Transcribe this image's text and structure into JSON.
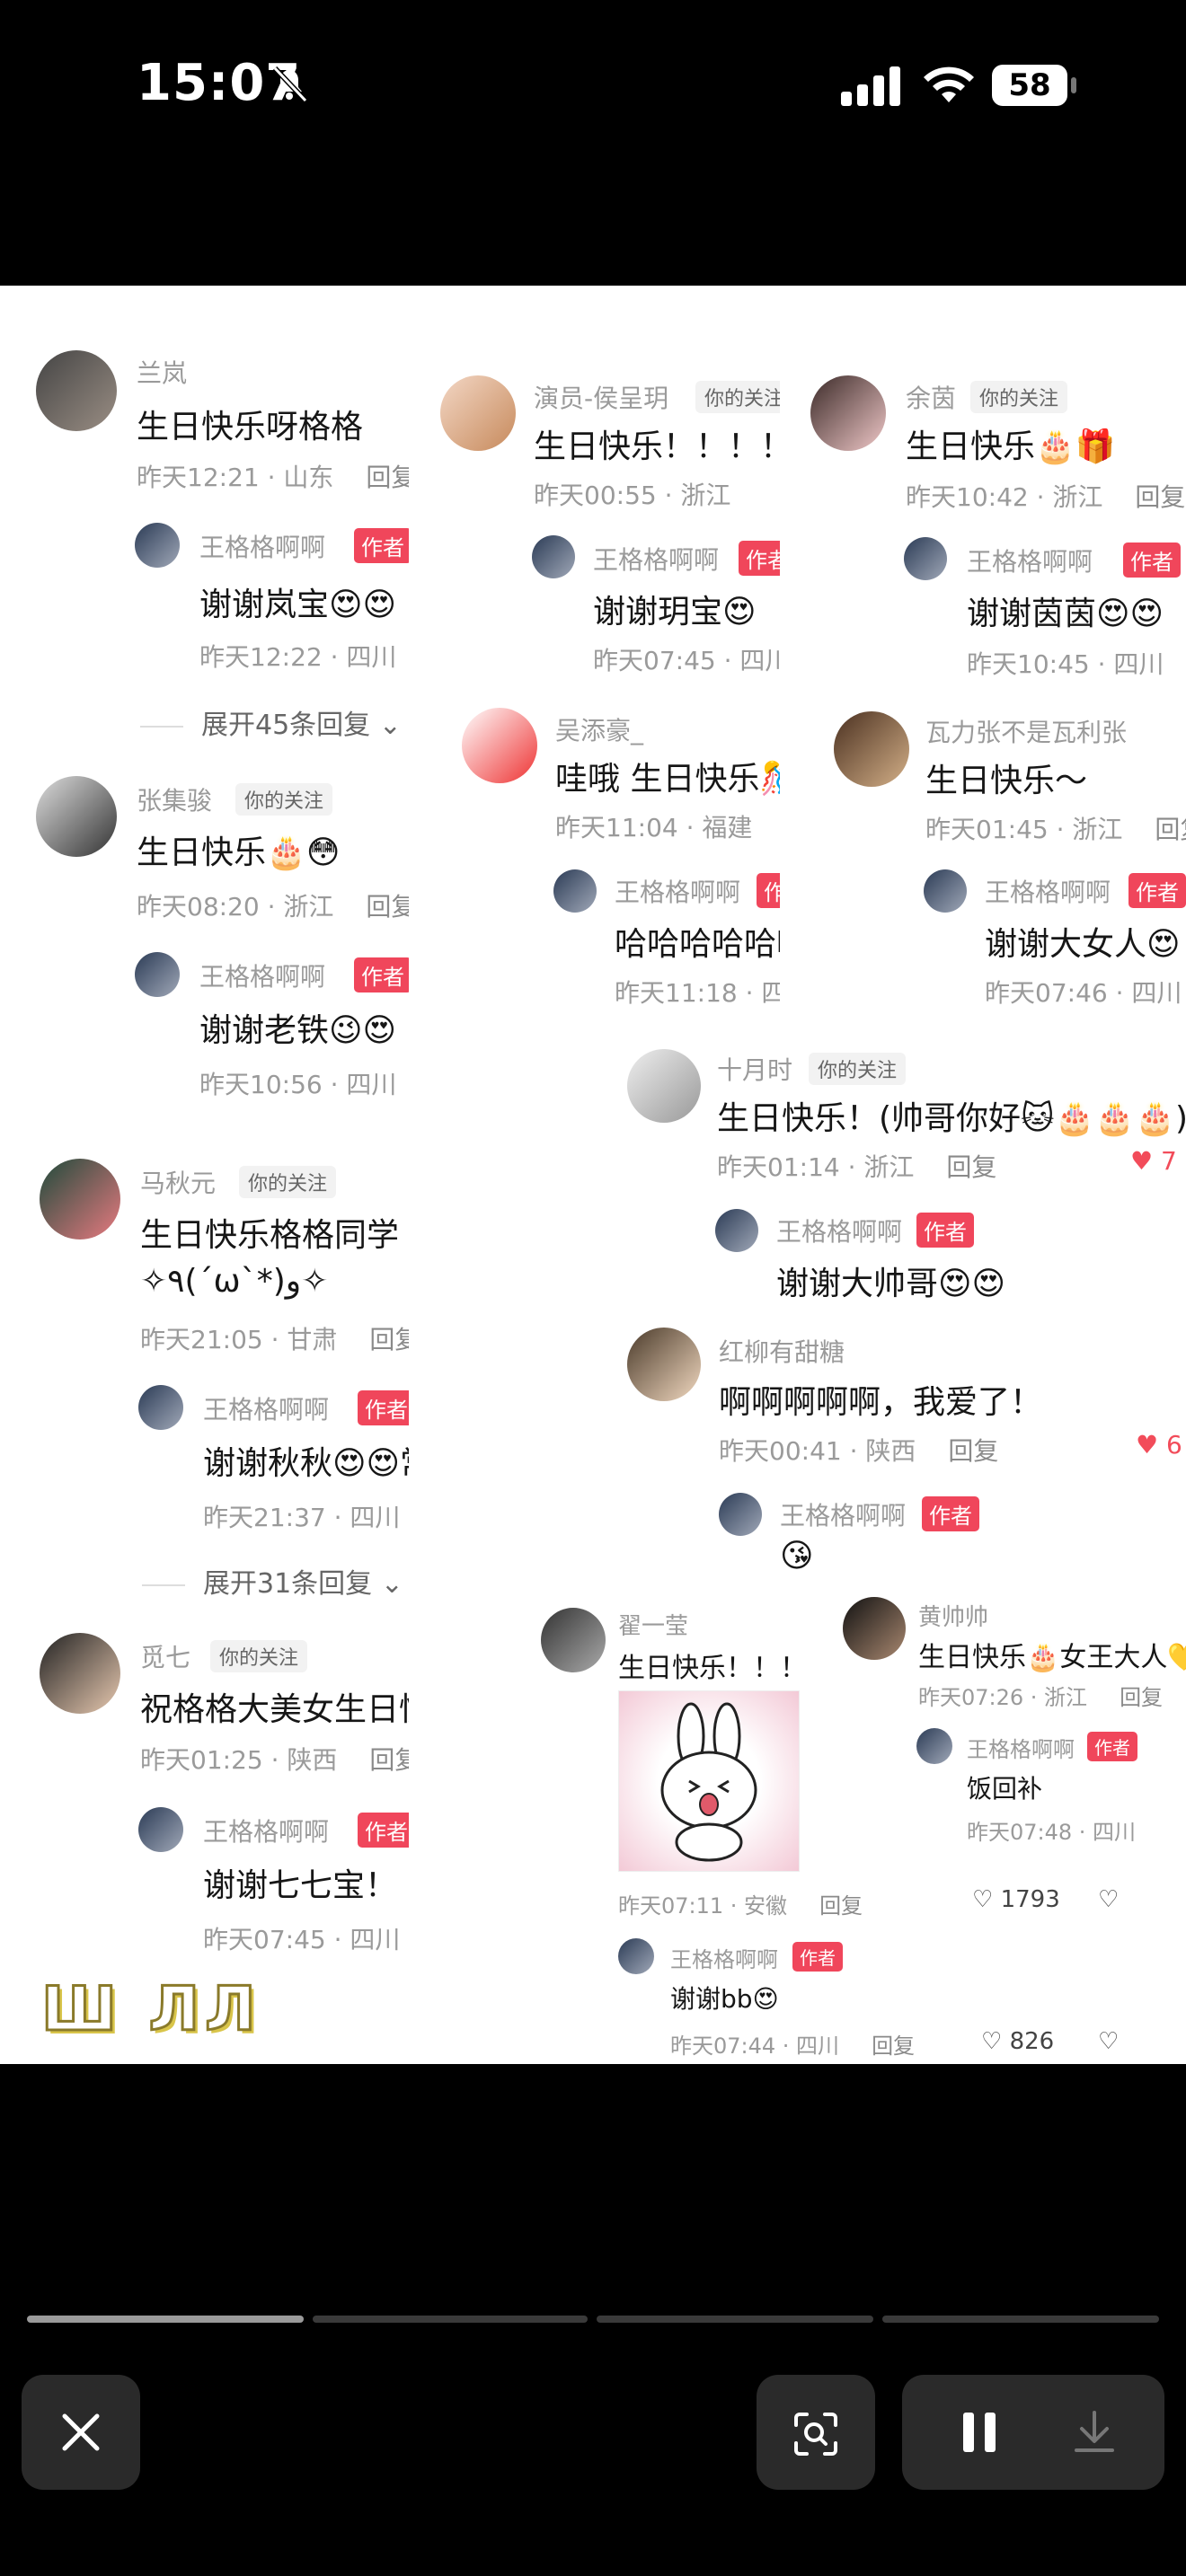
{
  "status": {
    "time": "15:07",
    "battery": "58"
  },
  "author_badge": "作者",
  "follow_tag": "你的关注",
  "reply_label": "回复",
  "col1": {
    "c1": {
      "name": "兰岚",
      "text": "生日快乐呀格格",
      "meta": "昨天12:21 · 山东",
      "reply_name": "王格格啊啊",
      "reply_text": "谢谢岚宝",
      "reply_meta": "昨天12:22 · 四川",
      "expand": "展开45条回复"
    },
    "c2": {
      "name": "张集骏",
      "text": "生日快乐🎂😳",
      "meta": "昨天08:20 · 浙江",
      "reply_name": "王格格啊啊",
      "reply_text": "谢谢老铁😉😍",
      "reply_meta": "昨天10:56 · 四川"
    },
    "c3": {
      "name": "马秋元",
      "text": "生日快乐格格同学  越来越好🎂",
      "text2": "✧٩(ˊωˋ*)و✧",
      "meta": "昨天21:05 · 甘肃",
      "reply_name": "王格格啊啊",
      "reply_text": "谢谢秋秋😍😍常见❤️",
      "reply_meta": "昨天21:37 · 四川",
      "expand": "展开31条回复"
    },
    "c4": {
      "name": "觅七",
      "text": "祝格格大美女生日快乐！",
      "meta": "昨天01:25 · 陕西",
      "reply_name": "王格格啊啊",
      "reply_text": "谢谢七七宝！ 😍😍",
      "reply_meta": "昨天07:45 · 四川"
    }
  },
  "col2": {
    "c1": {
      "name": "演员-侯呈玥",
      "text": "生日快乐！！！！",
      "meta": "昨天00:55 · 浙江",
      "reply_name": "王格格啊啊",
      "reply_text": "谢谢玥宝😍",
      "reply_meta": "昨天07:45 · 四川"
    },
    "c2": {
      "name": "吴添豪_",
      "text": "哇哦 生日快乐🎊",
      "meta": "昨天11:04 · 福建",
      "reply_name": "王格格啊啊",
      "reply_text": "哈哈哈哈哈哈",
      "reply_meta": "昨天11:18 · 四川"
    }
  },
  "col3": {
    "c1": {
      "name": "余茵",
      "text": "生日快乐🎂🎁",
      "meta": "昨天10:42 · 浙江",
      "reply_name": "王格格啊啊",
      "reply_text": "谢谢茵茵😍😍",
      "reply_meta": "昨天10:45 · 四川"
    },
    "c2": {
      "name": "瓦力张不是瓦利张",
      "text": "生日快乐～",
      "meta": "昨天01:45 · 浙江",
      "reply_name": "王格格啊啊",
      "reply_text": "谢谢大女人😍",
      "reply_meta": "昨天07:46 · 四川"
    }
  },
  "mid": {
    "c1": {
      "name": "十月时",
      "text": "生日快乐！(帅哥你好🐱🎂🎂🎂)",
      "meta": "昨天01:14 · 浙江",
      "likes": "7",
      "reply_name": "王格格啊啊",
      "reply_text": "谢谢大帅哥😍😍"
    },
    "c2": {
      "name": "红柳有甜糖",
      "text": "啊啊啊啊啊，我爱了！",
      "meta": "昨天00:41 · 陕西",
      "likes": "6",
      "reply_name": "王格格啊啊",
      "reply_text": "😘"
    }
  },
  "low": {
    "c1": {
      "name": "翟一莹",
      "text": "生日快乐！！！",
      "meta": "昨天07:11 · 安徽",
      "likes": "1793",
      "reply_name": "王格格啊啊",
      "reply_text": "谢谢bb😍",
      "reply_meta": "昨天07:44 · 四川",
      "reply_likes": "826"
    },
    "c2": {
      "name": "黄帅帅",
      "text": "生日快乐🎂女王大人💛",
      "meta": "昨天07:26 · 浙江",
      "reply_name": "王格格啊啊",
      "reply_text": "饭回补",
      "reply_meta": "昨天07:48 · 四川"
    }
  },
  "overlay_text": "Ш ЛЛ"
}
